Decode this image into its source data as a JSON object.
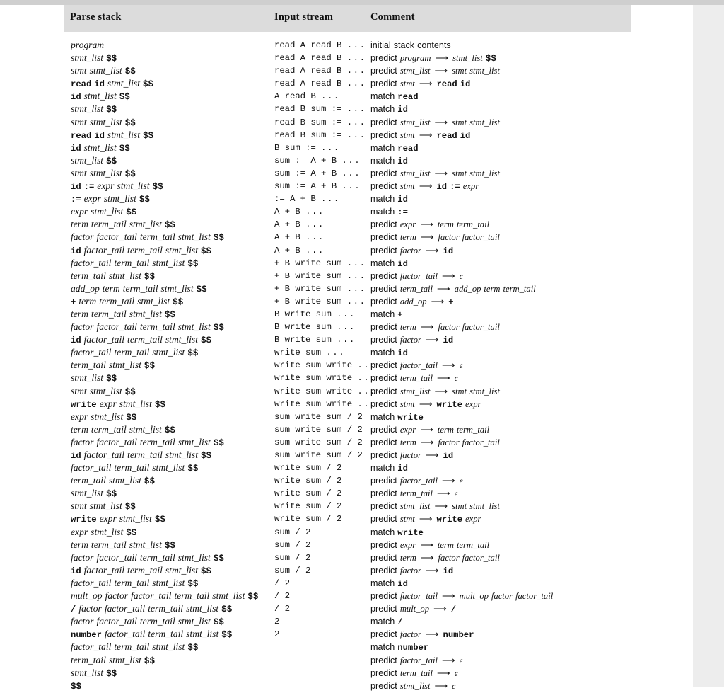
{
  "table": {
    "headers": [
      "Parse stack",
      "Input stream",
      "Comment"
    ],
    "rows": [
      {
        "stack": "program",
        "input": "read A read B ...",
        "comment": "initial stack contents"
      },
      {
        "stack": "stmt_list $$",
        "input": "read A read B ...",
        "comment": "predict program ⟶ stmt_list $$"
      },
      {
        "stack": "stmt stmt_list $$",
        "input": "read A read B ...",
        "comment": "predict stmt_list ⟶ stmt stmt_list"
      },
      {
        "stack": "read id stmt_list $$",
        "input": "read A read B ...",
        "comment": "predict stmt ⟶ read id"
      },
      {
        "stack": "id stmt_list $$",
        "input": "A read B ...",
        "comment": "match read"
      },
      {
        "stack": "stmt_list $$",
        "input": "read B sum := ...",
        "comment": "match id"
      },
      {
        "stack": "stmt stmt_list $$",
        "input": "read B sum := ...",
        "comment": "predict stmt_list ⟶ stmt stmt_list"
      },
      {
        "stack": "read id stmt_list $$",
        "input": "read B sum := ...",
        "comment": "predict stmt ⟶ read id"
      },
      {
        "stack": "id stmt_list $$",
        "input": "B sum := ...",
        "comment": "match read"
      },
      {
        "stack": "stmt_list $$",
        "input": "sum := A + B ...",
        "comment": "match id"
      },
      {
        "stack": "stmt stmt_list $$",
        "input": "sum := A + B ...",
        "comment": "predict stmt_list ⟶ stmt stmt_list"
      },
      {
        "stack": "id := expr stmt_list $$",
        "input": "sum := A + B ...",
        "comment": "predict stmt ⟶ id := expr"
      },
      {
        "stack": ":= expr stmt_list $$",
        "input": ":= A + B ...",
        "comment": "match id"
      },
      {
        "stack": "expr stmt_list $$",
        "input": "A + B ...",
        "comment": "match :="
      },
      {
        "stack": "term term_tail stmt_list $$",
        "input": "A + B ...",
        "comment": "predict expr ⟶ term term_tail"
      },
      {
        "stack": "factor factor_tail term_tail stmt_list $$",
        "input": "A + B ...",
        "comment": "predict term ⟶ factor factor_tail"
      },
      {
        "stack": "id factor_tail term_tail stmt_list $$",
        "input": "A + B ...",
        "comment": "predict factor ⟶ id"
      },
      {
        "stack": "factor_tail term_tail stmt_list $$",
        "input": "+ B write sum ...",
        "comment": "match id"
      },
      {
        "stack": "term_tail stmt_list $$",
        "input": "+ B write sum ...",
        "comment": "predict factor_tail ⟶ ϵ"
      },
      {
        "stack": "add_op term term_tail stmt_list $$",
        "input": "+ B write sum ...",
        "comment": "predict term_tail ⟶ add_op term term_tail"
      },
      {
        "stack": "+ term term_tail stmt_list $$",
        "input": "+ B write sum ...",
        "comment": "predict add_op ⟶ +"
      },
      {
        "stack": "term term_tail stmt_list $$",
        "input": "B write sum ...",
        "comment": "match +"
      },
      {
        "stack": "factor factor_tail term_tail stmt_list $$",
        "input": "B write sum ...",
        "comment": "predict term ⟶ factor factor_tail"
      },
      {
        "stack": "id factor_tail term_tail stmt_list $$",
        "input": "B write sum ...",
        "comment": "predict factor ⟶ id"
      },
      {
        "stack": "factor_tail term_tail stmt_list $$",
        "input": "write sum ...",
        "comment": "match id"
      },
      {
        "stack": "term_tail stmt_list $$",
        "input": "write sum write ...",
        "comment": "predict factor_tail ⟶ ϵ"
      },
      {
        "stack": "stmt_list $$",
        "input": "write sum write ...",
        "comment": "predict term_tail ⟶ ϵ"
      },
      {
        "stack": "stmt stmt_list $$",
        "input": "write sum write ...",
        "comment": "predict stmt_list ⟶ stmt stmt_list"
      },
      {
        "stack": "write expr stmt_list $$",
        "input": "write sum write ...",
        "comment": "predict stmt ⟶ write expr"
      },
      {
        "stack": "expr stmt_list $$",
        "input": "sum write sum / 2",
        "comment": "match write"
      },
      {
        "stack": "term term_tail stmt_list $$",
        "input": "sum write sum / 2",
        "comment": "predict expr ⟶ term term_tail"
      },
      {
        "stack": "factor factor_tail term_tail stmt_list $$",
        "input": "sum write sum / 2",
        "comment": "predict term ⟶ factor factor_tail"
      },
      {
        "stack": "id factor_tail term_tail stmt_list $$",
        "input": "sum write sum / 2",
        "comment": "predict factor ⟶ id"
      },
      {
        "stack": "factor_tail term_tail stmt_list $$",
        "input": "write sum / 2",
        "comment": "match id"
      },
      {
        "stack": "term_tail stmt_list $$",
        "input": "write sum / 2",
        "comment": "predict factor_tail ⟶ ϵ"
      },
      {
        "stack": "stmt_list $$",
        "input": "write sum / 2",
        "comment": "predict term_tail ⟶ ϵ"
      },
      {
        "stack": "stmt stmt_list $$",
        "input": "write sum / 2",
        "comment": "predict stmt_list ⟶ stmt stmt_list"
      },
      {
        "stack": "write expr stmt_list $$",
        "input": "write sum / 2",
        "comment": "predict stmt ⟶ write expr"
      },
      {
        "stack": "expr stmt_list $$",
        "input": "sum / 2",
        "comment": "match write"
      },
      {
        "stack": "term term_tail stmt_list $$",
        "input": "sum / 2",
        "comment": "predict expr ⟶ term term_tail"
      },
      {
        "stack": "factor factor_tail term_tail stmt_list $$",
        "input": "sum / 2",
        "comment": "predict term ⟶ factor factor_tail"
      },
      {
        "stack": "id factor_tail term_tail stmt_list $$",
        "input": "sum / 2",
        "comment": "predict factor ⟶ id"
      },
      {
        "stack": "factor_tail term_tail stmt_list $$",
        "input": "/ 2",
        "comment": "match id"
      },
      {
        "stack": "mult_op factor factor_tail term_tail stmt_list $$",
        "input": "/ 2",
        "comment": "predict factor_tail ⟶ mult_op factor factor_tail"
      },
      {
        "stack": "/ factor factor_tail term_tail stmt_list $$",
        "input": "/ 2",
        "comment": "predict mult_op ⟶ /"
      },
      {
        "stack": "factor factor_tail term_tail stmt_list $$",
        "input": "2",
        "comment": "match /"
      },
      {
        "stack": "number factor_tail term_tail stmt_list $$",
        "input": "2",
        "comment": "predict factor ⟶ number"
      },
      {
        "stack": "factor_tail term_tail stmt_list $$",
        "input": "",
        "comment": "match number"
      },
      {
        "stack": "term_tail stmt_list $$",
        "input": "",
        "comment": "predict factor_tail ⟶ ϵ"
      },
      {
        "stack": "stmt_list $$",
        "input": "",
        "comment": "predict term_tail ⟶ ϵ"
      },
      {
        "stack": "$$",
        "input": "",
        "comment": "predict stmt_list ⟶ ϵ"
      }
    ]
  },
  "tokens": {
    "terminals": [
      "read",
      "id",
      "write",
      "number",
      "$$",
      ":=",
      "+",
      "/",
      "A",
      "B",
      "sum",
      "2",
      "..."
    ],
    "nonterminals": [
      "program",
      "stmt_list",
      "stmt",
      "expr",
      "term",
      "term_tail",
      "factor",
      "factor_tail",
      "add_op",
      "mult_op"
    ],
    "epsilon": "ϵ",
    "arrow": "⟶"
  },
  "colors": {
    "header_band": "#dcdcdc",
    "page_background": "#ffffff",
    "gutter": "#ededed",
    "top_strip": "#cfcfcf",
    "text": "#111111"
  }
}
